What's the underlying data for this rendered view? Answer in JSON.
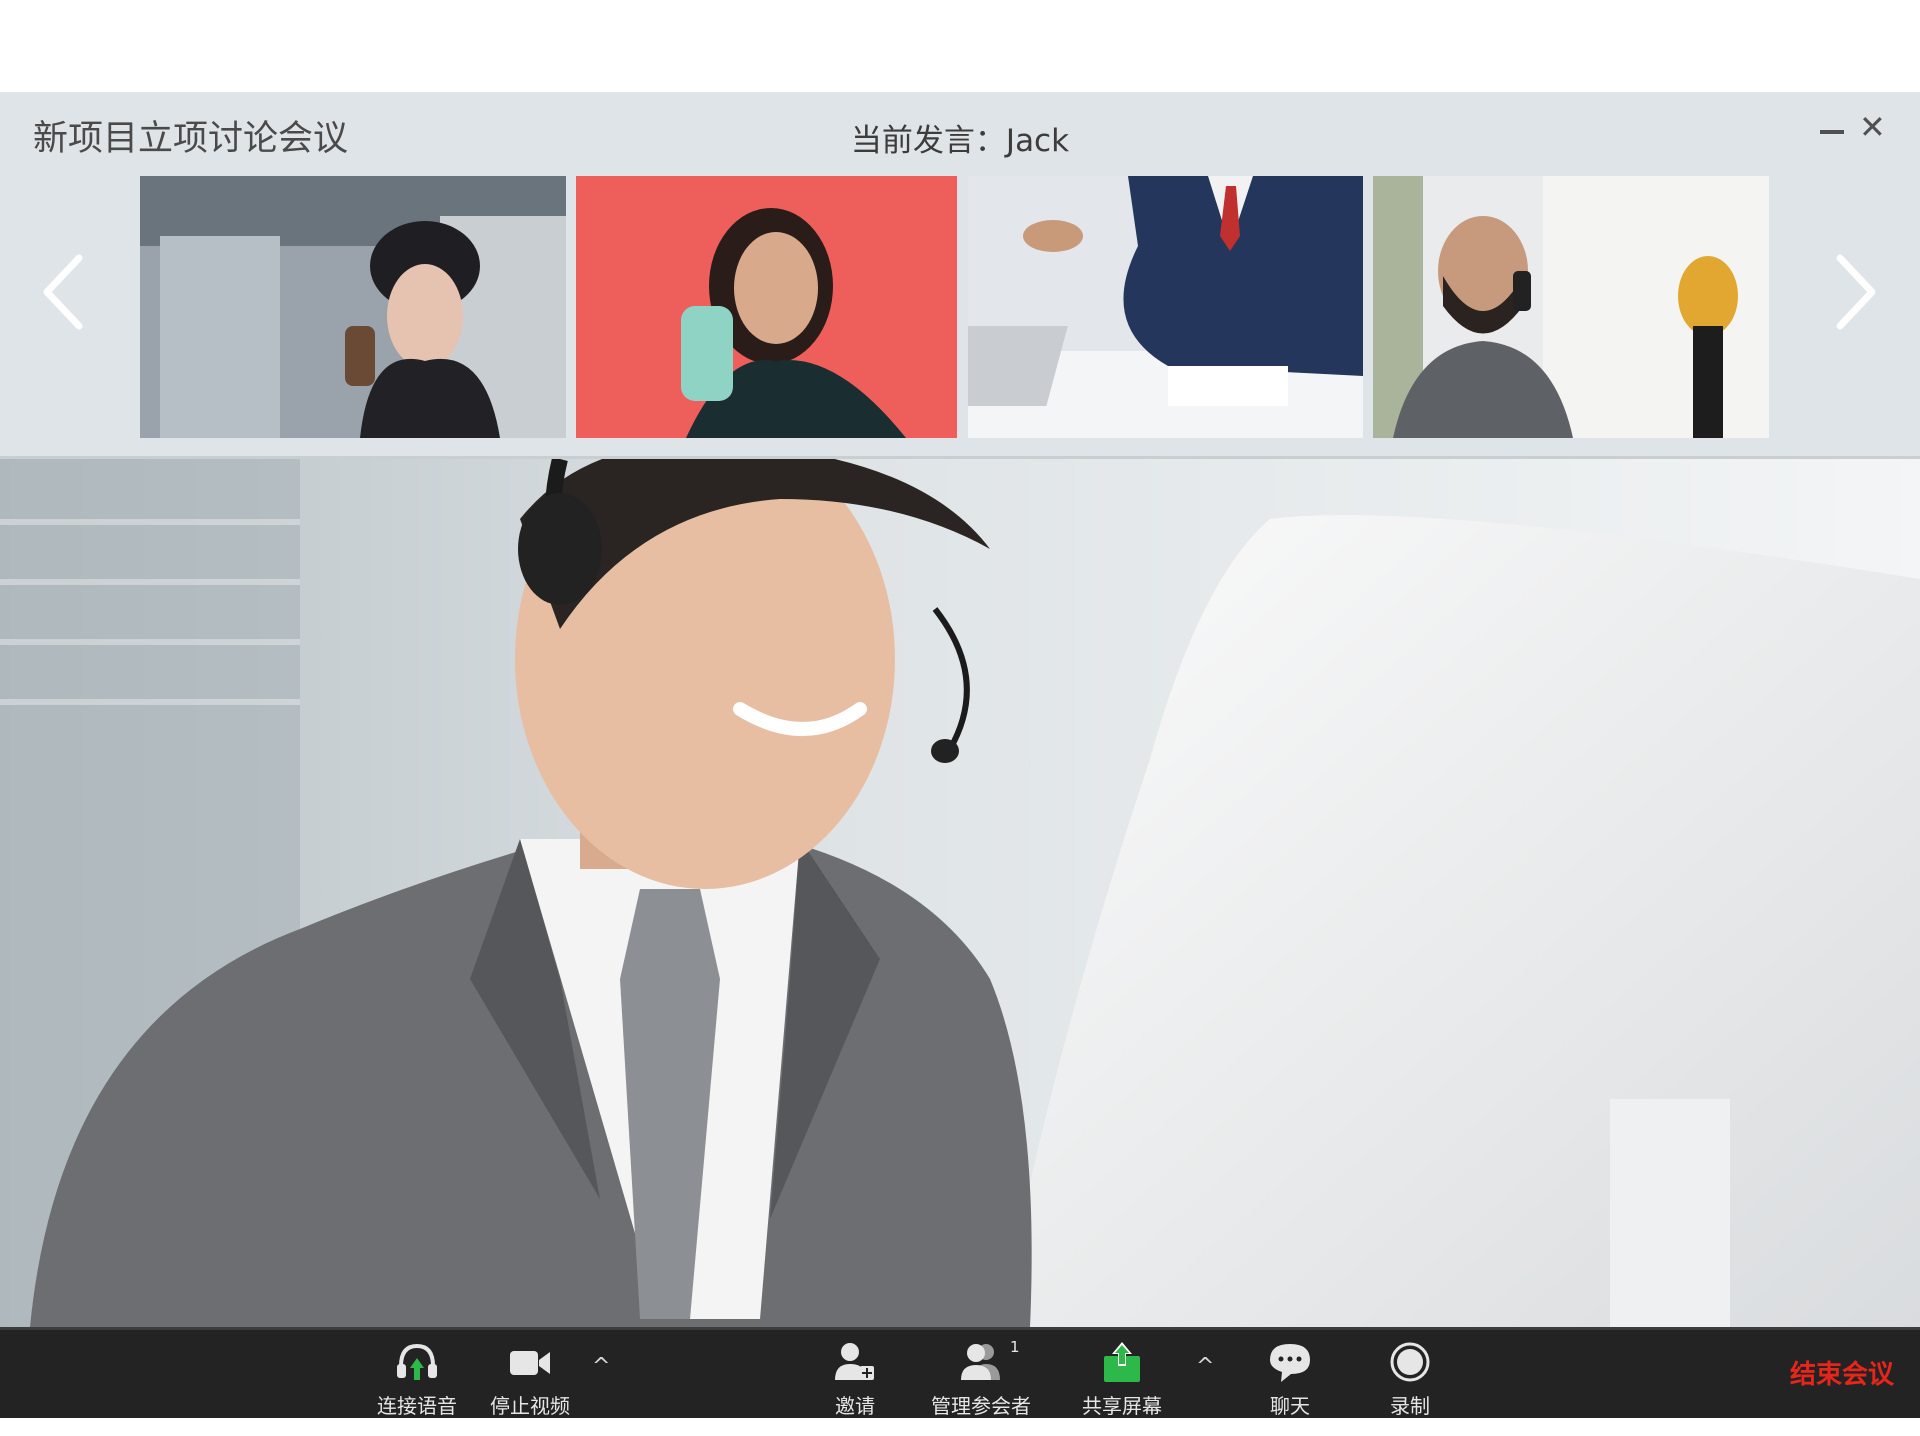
{
  "header": {
    "title": "新项目立项讨论会议",
    "speaker_label": "当前发言：",
    "speaker_name": "Jack",
    "thumbnails": [
      {
        "name": "participant-1"
      },
      {
        "name": "participant-2"
      },
      {
        "name": "participant-3"
      },
      {
        "name": "participant-4"
      }
    ]
  },
  "toolbar": {
    "buttons": [
      {
        "label": "连接语音",
        "icon": "headphone-icon"
      },
      {
        "label": "停止视频",
        "icon": "video-camera-icon"
      },
      {
        "label": "邀请",
        "icon": "add-user-icon"
      },
      {
        "label": "管理参会者",
        "icon": "participants-icon",
        "count": "1"
      },
      {
        "label": "共享屏幕",
        "icon": "share-screen-icon"
      },
      {
        "label": "聊天",
        "icon": "chat-icon"
      },
      {
        "label": "录制",
        "icon": "record-icon"
      }
    ],
    "caret": "^",
    "end_label": "结束会议"
  },
  "colors": {
    "header_bg": "#dfe4e8",
    "toolbar_bg": "#232323",
    "accent_green": "#2db84a",
    "end_red": "#e8251b"
  }
}
